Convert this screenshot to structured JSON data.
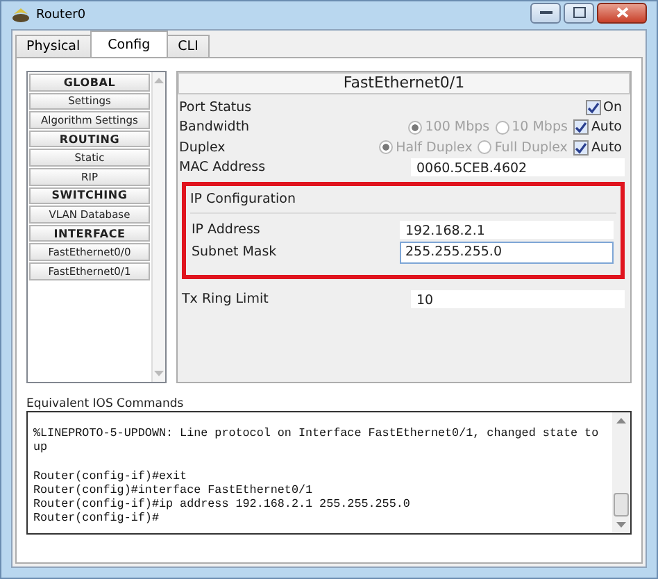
{
  "window": {
    "title": "Router0"
  },
  "tabs": [
    {
      "label": "Physical",
      "selected": false
    },
    {
      "label": "Config",
      "selected": true
    },
    {
      "label": "CLI",
      "selected": false
    }
  ],
  "sidebar": {
    "items": [
      {
        "label": "GLOBAL",
        "kind": "header"
      },
      {
        "label": "Settings",
        "kind": "item"
      },
      {
        "label": "Algorithm Settings",
        "kind": "item"
      },
      {
        "label": "ROUTING",
        "kind": "header"
      },
      {
        "label": "Static",
        "kind": "item"
      },
      {
        "label": "RIP",
        "kind": "item"
      },
      {
        "label": "SWITCHING",
        "kind": "header"
      },
      {
        "label": "VLAN Database",
        "kind": "item"
      },
      {
        "label": "INTERFACE",
        "kind": "header"
      },
      {
        "label": "FastEthernet0/0",
        "kind": "item"
      },
      {
        "label": "FastEthernet0/1",
        "kind": "item"
      }
    ]
  },
  "interface_panel": {
    "title": "FastEthernet0/1",
    "port_status": {
      "label": "Port Status",
      "on": {
        "label": "On",
        "checked": true
      }
    },
    "bandwidth": {
      "label": "Bandwidth",
      "options": [
        {
          "label": "100 Mbps",
          "selected": true,
          "disabled": true
        },
        {
          "label": "10 Mbps",
          "selected": false,
          "disabled": true
        }
      ],
      "auto": {
        "label": "Auto",
        "checked": true
      }
    },
    "duplex": {
      "label": "Duplex",
      "options": [
        {
          "label": "Half Duplex",
          "selected": true,
          "disabled": true
        },
        {
          "label": "Full Duplex",
          "selected": false,
          "disabled": true
        }
      ],
      "auto": {
        "label": "Auto",
        "checked": true
      }
    },
    "mac_address": {
      "label": "MAC Address",
      "value": "0060.5CEB.4602"
    },
    "ip_configuration": {
      "title": "IP Configuration",
      "fields": [
        {
          "label": "IP Address",
          "value": "192.168.2.1",
          "focused": false
        },
        {
          "label": "Subnet Mask",
          "value": "255.255.255.0",
          "focused": true
        }
      ]
    },
    "tx_ring_limit": {
      "label": "Tx Ring Limit",
      "value": "10"
    }
  },
  "console": {
    "label": "Equivalent IOS Commands",
    "lines": [
      {
        "kind": "blank"
      },
      {
        "kind": "text",
        "text": "%LINEPROTO-5-UPDOWN: Line protocol on Interface FastEthernet0/1, changed state to"
      },
      {
        "kind": "text",
        "text": "up"
      },
      {
        "kind": "blank"
      },
      {
        "kind": "text",
        "text": "Router(config-if)#exit"
      },
      {
        "kind": "text",
        "text": "Router(config)#interface FastEthernet0/1"
      },
      {
        "kind": "text",
        "text": "Router(config-if)#ip address 192.168.2.1 255.255.255.0"
      },
      {
        "kind": "text",
        "text": "Router(config-if)#"
      }
    ]
  }
}
